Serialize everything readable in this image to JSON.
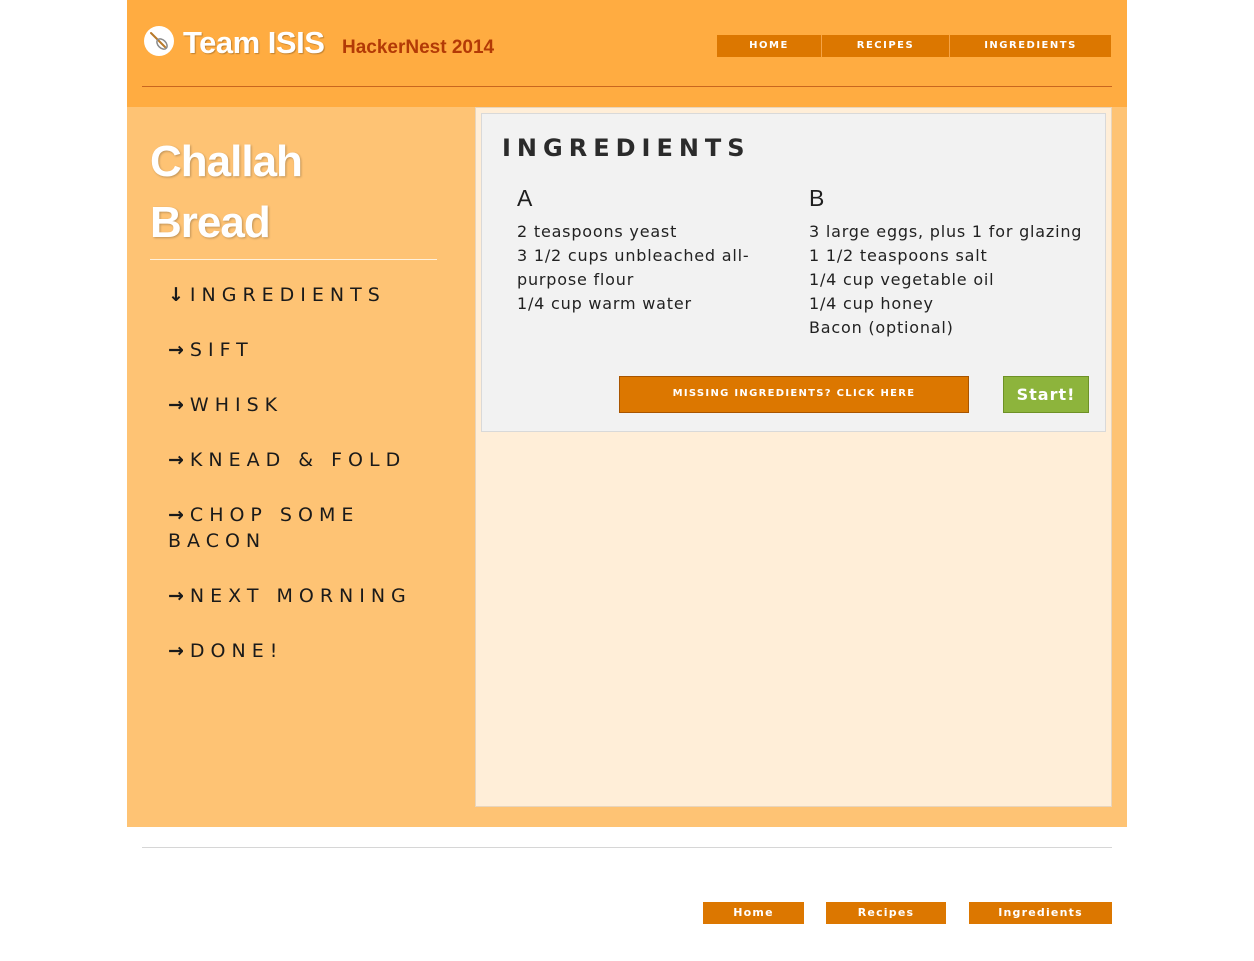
{
  "header": {
    "brand": "Team ISIS",
    "event": "HackerNest 2014",
    "logo_icon": "whisk-icon",
    "nav": [
      {
        "label": "HOME"
      },
      {
        "label": "RECIPES"
      },
      {
        "label": "INGREDIENTS"
      }
    ]
  },
  "sidebar": {
    "title_line1": "Challah",
    "title_line2": "Bread",
    "steps": [
      {
        "arrow": "↓",
        "label": "INGREDIENTS",
        "active": true
      },
      {
        "arrow": "→",
        "label": "SIFT"
      },
      {
        "arrow": "→",
        "label": "WHISK"
      },
      {
        "arrow": "→",
        "label": "KNEAD & FOLD"
      },
      {
        "arrow": "→",
        "label": "CHOP SOME BACON"
      },
      {
        "arrow": "→",
        "label": "NEXT MORNING"
      },
      {
        "arrow": "→",
        "label": "DONE!"
      }
    ]
  },
  "ingredients": {
    "title": "INGREDIENTS",
    "col_a": {
      "heading": "A",
      "items": [
        "2 teaspoons yeast",
        "3 1/2 cups unbleached all-purpose flour",
        "1/4 cup warm water"
      ]
    },
    "col_b": {
      "heading": "B",
      "items": [
        "3 large eggs, plus 1 for glazing",
        "1 1/2 teaspoons salt",
        "1/4 cup vegetable oil",
        "1/4 cup honey",
        "Bacon (optional)"
      ]
    },
    "missing_button": "MISSING INGREDIENTS? CLICK HERE",
    "start_button": "Start!"
  },
  "footer": {
    "nav": [
      {
        "label": "Home"
      },
      {
        "label": "Recipes"
      },
      {
        "label": "Ingredients"
      }
    ]
  },
  "colors": {
    "header_bg": "#ffac41",
    "content_bg": "#fec374",
    "panel_bg": "#ffeed8",
    "nav_button": "#dc7700",
    "start_button": "#8db43c",
    "event_text": "#b33a06"
  }
}
